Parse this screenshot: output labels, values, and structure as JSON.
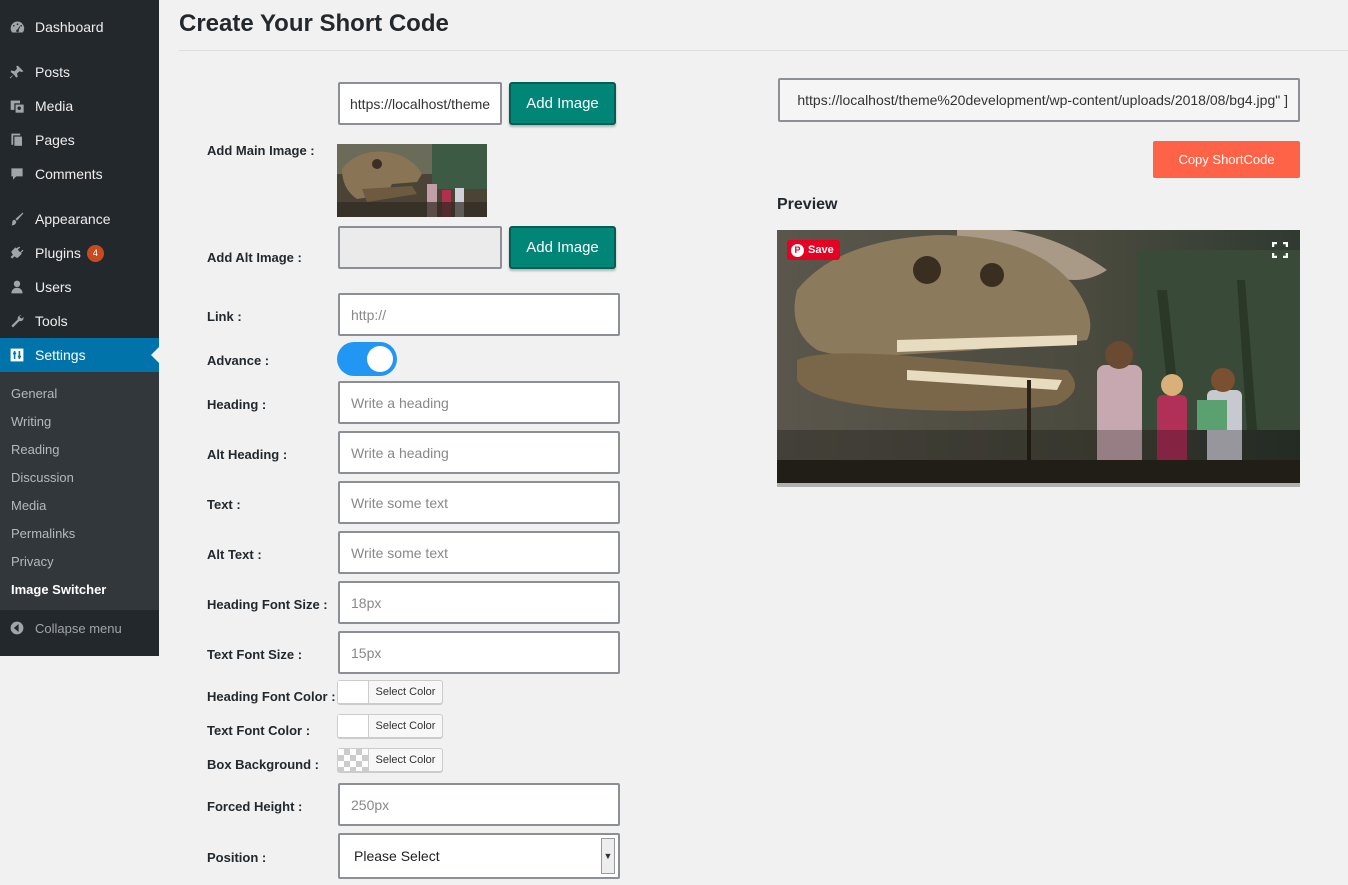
{
  "sidebar": {
    "items": [
      {
        "label": "Dashboard",
        "icon": "dashboard-icon"
      },
      {
        "label": "Posts",
        "icon": "pin-icon"
      },
      {
        "label": "Media",
        "icon": "media-icon"
      },
      {
        "label": "Pages",
        "icon": "pages-icon"
      },
      {
        "label": "Comments",
        "icon": "comments-icon"
      },
      {
        "label": "Appearance",
        "icon": "paintbrush-icon"
      },
      {
        "label": "Plugins",
        "icon": "plugin-icon",
        "badge": "4"
      },
      {
        "label": "Users",
        "icon": "users-icon"
      },
      {
        "label": "Tools",
        "icon": "wrench-icon"
      },
      {
        "label": "Settings",
        "icon": "settings-icon",
        "active": true
      }
    ],
    "submenu": [
      "General",
      "Writing",
      "Reading",
      "Discussion",
      "Media",
      "Permalinks",
      "Privacy",
      "Image Switcher"
    ],
    "current_submenu": "Image Switcher",
    "collapse_label": "Collapse menu"
  },
  "page": {
    "title": "Create Your Short Code"
  },
  "form": {
    "main_image": {
      "label": "Add Main Image :",
      "url_value": "https://localhost/theme",
      "button": "Add Image"
    },
    "alt_image": {
      "label": "Add Alt Image :",
      "url_value": "",
      "button": "Add Image"
    },
    "link": {
      "label": "Link :",
      "placeholder": "http://"
    },
    "advance": {
      "label": "Advance :",
      "enabled": true
    },
    "heading": {
      "label": "Heading :",
      "placeholder": "Write a heading"
    },
    "alt_heading": {
      "label": "Alt Heading :",
      "placeholder": "Write a heading"
    },
    "text": {
      "label": "Text :",
      "placeholder": "Write some text"
    },
    "alt_text": {
      "label": "Alt Text :",
      "placeholder": "Write some text"
    },
    "heading_font_size": {
      "label": "Heading Font Size :",
      "placeholder": "18px"
    },
    "text_font_size": {
      "label": "Text Font Size :",
      "placeholder": "15px"
    },
    "heading_font_color": {
      "label": "Heading Font Color :",
      "button": "Select Color"
    },
    "text_font_color": {
      "label": "Text Font Color :",
      "button": "Select Color"
    },
    "box_background": {
      "label": "Box Background :",
      "button": "Select Color"
    },
    "forced_height": {
      "label": "Forced Height :",
      "placeholder": "250px"
    },
    "position": {
      "label": "Position :",
      "selected": "Please Select"
    }
  },
  "shortcode": {
    "value": "https://localhost/theme%20development/wp-content/uploads/2018/08/bg4.jpg\" ]",
    "copy_button": "Copy ShortCode"
  },
  "preview": {
    "label": "Preview",
    "pin_save": "Save"
  },
  "colors": {
    "sidebar_bg": "#23282d",
    "active_blue": "#0073aa",
    "add_image_teal": "#008577",
    "copy_button": "#ff6347",
    "toggle_on": "#2196f3",
    "badge": "#ca4a1f"
  }
}
